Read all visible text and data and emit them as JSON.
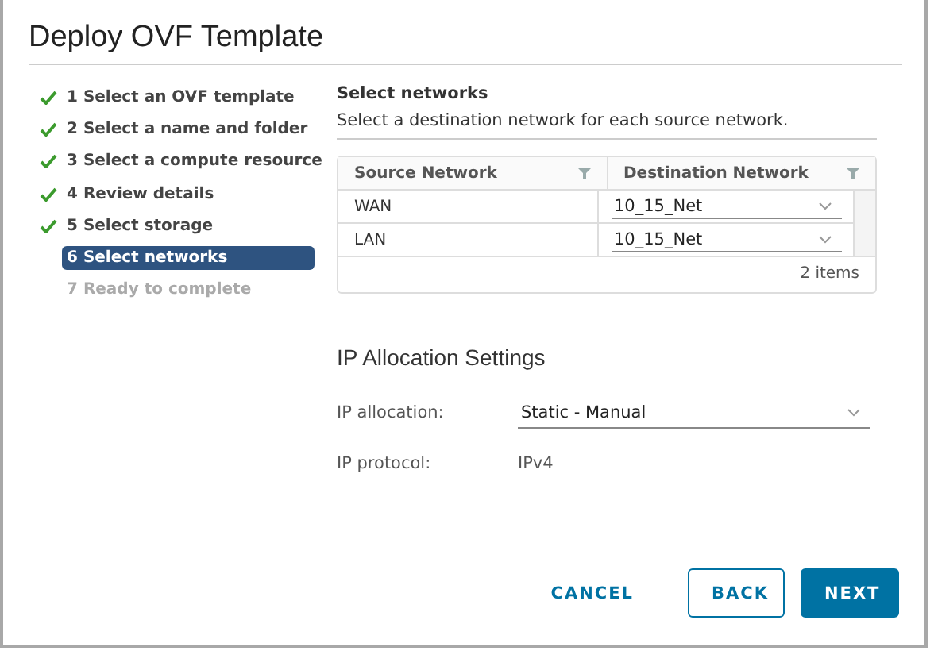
{
  "window": {
    "title": "Deploy OVF Template"
  },
  "steps": [
    {
      "label": "1 Select an OVF template",
      "completed": true,
      "selected": false
    },
    {
      "label": "2 Select a name and folder",
      "completed": true,
      "selected": false
    },
    {
      "label": "3 Select a compute resource",
      "completed": true,
      "selected": false
    },
    {
      "label": "4 Review details",
      "completed": true,
      "selected": false
    },
    {
      "label": "5 Select storage",
      "completed": true,
      "selected": false
    },
    {
      "label": "6 Select networks",
      "completed": false,
      "selected": true
    },
    {
      "label": "7 Ready to complete",
      "completed": false,
      "selected": false
    }
  ],
  "section": {
    "title": "Select networks",
    "description": "Select a destination network for each source network."
  },
  "table": {
    "columns": [
      "Source Network",
      "Destination Network"
    ],
    "rows": [
      {
        "source": "WAN",
        "destination": "10_15_Net"
      },
      {
        "source": "LAN",
        "destination": "10_15_Net"
      }
    ],
    "footer": "2 items"
  },
  "ip_settings": {
    "title": "IP Allocation Settings",
    "allocation_label": "IP allocation:",
    "allocation_value": "Static - Manual",
    "protocol_label": "IP protocol:",
    "protocol_value": "IPv4"
  },
  "buttons": {
    "cancel": "CANCEL",
    "back": "BACK",
    "next": "NEXT"
  }
}
